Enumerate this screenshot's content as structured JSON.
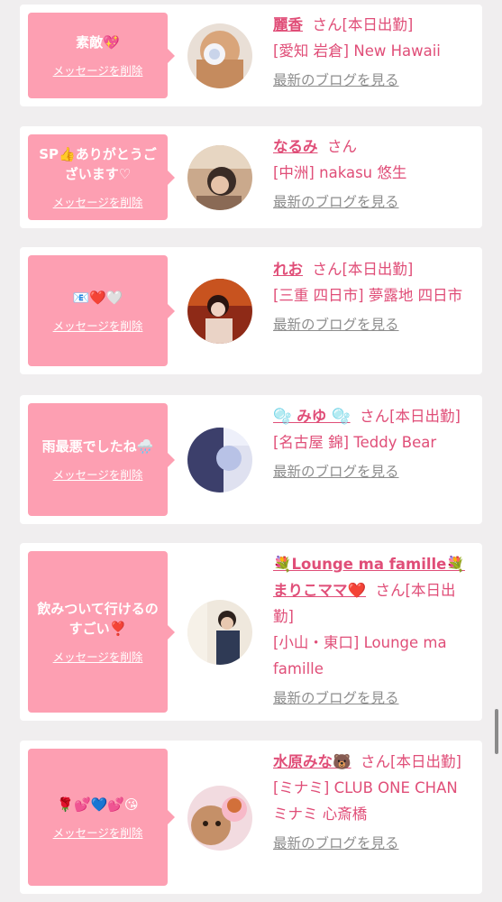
{
  "delete_label": "メッセージを削除",
  "blog_label": "最新のブログを見る",
  "san_suffix": "さん",
  "items": [
    {
      "message": "素敵💖",
      "name": "麗香",
      "status": "[本日出勤]",
      "location": "[愛知 岩倉] New Hawaii"
    },
    {
      "message": "SP👍ありがとうございます♡",
      "name": "なるみ",
      "status": "",
      "location": "[中洲] nakasu 悠生"
    },
    {
      "message": "📧❤️🤍",
      "name": "れお",
      "status": "[本日出勤]",
      "location": "[三重 四日市] 夢露地 四日市"
    },
    {
      "message": "雨最悪でしたね🌧️",
      "name": "🫧 みゆ 🫧",
      "status": "[本日出勤]",
      "location": "[名古屋 錦] Teddy Bear"
    },
    {
      "message": "飲みついて行けるのすごい❣️",
      "name": "💐Lounge ma famille💐 まりこママ❤️",
      "status": "[本日出勤]",
      "location": "[小山・東口] Lounge ma famille"
    },
    {
      "message": "🌹💕💙💕😘",
      "name": "水原みな🐻",
      "status": "[本日出勤]",
      "location": "[ミナミ] CLUB ONE CHAN ミナミ 心斎橋"
    }
  ]
}
